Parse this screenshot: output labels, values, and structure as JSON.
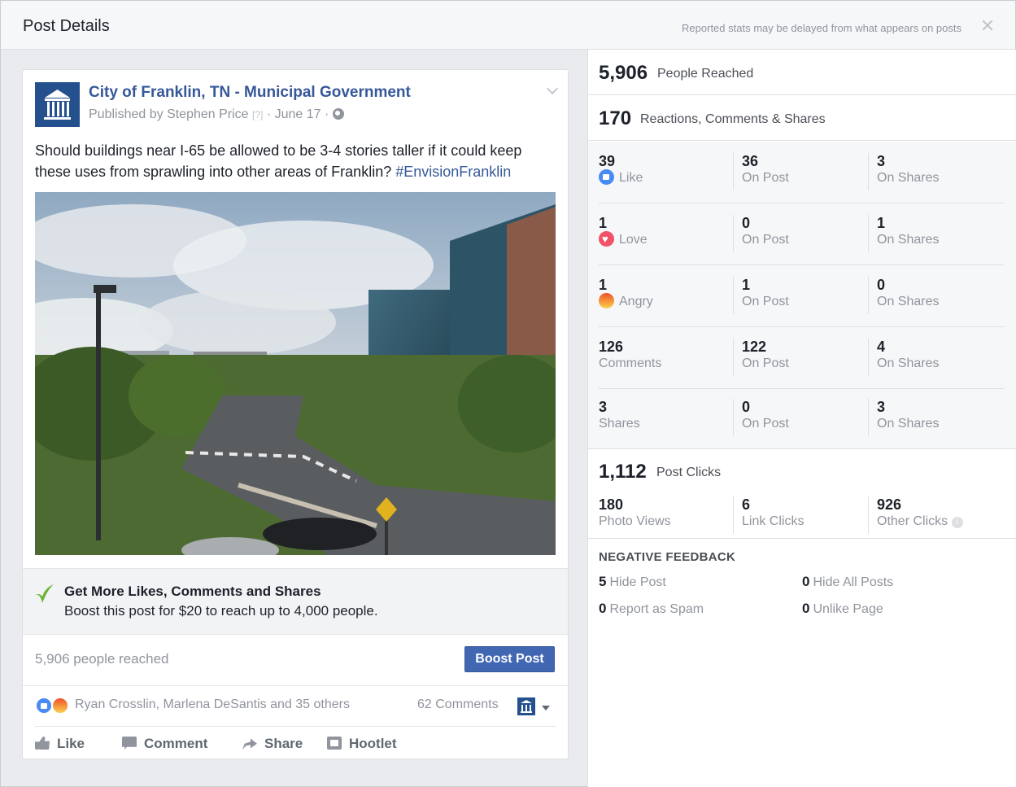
{
  "header": {
    "title": "Post Details",
    "note": "Reported stats may be delayed from what appears on posts"
  },
  "post": {
    "page_name": "City of Franklin, TN - Municipal Government",
    "published_by": "Published by Stephen Price",
    "help_mark": "[?]",
    "date": "· June 17 ·",
    "text": "Should buildings near I-65 be allowed to be 3-4 stories taller if it could keep these uses from sprawling into other areas of Franklin?",
    "hashtag": "#EnvisionFranklin"
  },
  "boost_promo": {
    "title": "Get More Likes, Comments and Shares",
    "subtitle": "Boost this post for $20 to reach up to 4,000 people."
  },
  "footer": {
    "reached": "5,906 people reached",
    "boost_button": "Boost Post",
    "reactors": "Ryan Crosslin, Marlena DeSantis and 35 others",
    "comments_count": "62 Comments",
    "actions": [
      "Like",
      "Comment",
      "Share",
      "Hootlet"
    ]
  },
  "stats": {
    "people_reached": {
      "value": "5,906",
      "label": "People Reached"
    },
    "engagement": {
      "value": "170",
      "label": "Reactions, Comments & Shares"
    },
    "breakdown": [
      {
        "total": "39",
        "label": "Like",
        "icon": "like-icon",
        "on_post": "36",
        "on_post_label": "On Post",
        "on_shares": "3",
        "on_shares_label": "On Shares"
      },
      {
        "total": "1",
        "label": "Love",
        "icon": "love-icon",
        "on_post": "0",
        "on_post_label": "On Post",
        "on_shares": "1",
        "on_shares_label": "On Shares"
      },
      {
        "total": "1",
        "label": "Angry",
        "icon": "angry-icon",
        "on_post": "1",
        "on_post_label": "On Post",
        "on_shares": "0",
        "on_shares_label": "On Shares"
      },
      {
        "total": "126",
        "label": "Comments",
        "on_post": "122",
        "on_post_label": "On Post",
        "on_shares": "4",
        "on_shares_label": "On Shares"
      },
      {
        "total": "3",
        "label": "Shares",
        "on_post": "0",
        "on_post_label": "On Post",
        "on_shares": "3",
        "on_shares_label": "On Shares"
      }
    ],
    "post_clicks": {
      "value": "1,112",
      "label": "Post Clicks",
      "photo_views": "180",
      "photo_views_label": "Photo Views",
      "link_clicks": "6",
      "link_clicks_label": "Link Clicks",
      "other_clicks": "926",
      "other_clicks_label": "Other Clicks"
    },
    "negative_feedback": {
      "title": "NEGATIVE FEEDBACK",
      "hide_post": "5",
      "hide_post_label": "Hide Post",
      "hide_all": "0",
      "hide_all_label": "Hide All Posts",
      "spam": "0",
      "spam_label": "Report as Spam",
      "unlike": "0",
      "unlike_label": "Unlike Page"
    }
  },
  "colors": {
    "link_blue": "#365899",
    "button_blue": "#4267b2",
    "like_blue": "#4a8af4",
    "love_red": "#f25268",
    "leaf_green": "#6bb333"
  }
}
